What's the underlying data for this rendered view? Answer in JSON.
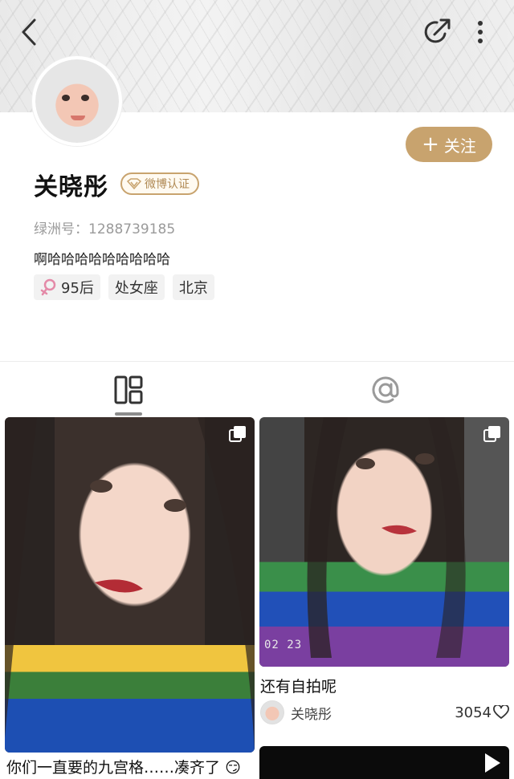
{
  "header": {
    "back_icon": "chevron-left-icon",
    "share_icon": "share-arrow-icon",
    "more_icon": "more-vertical-icon"
  },
  "profile": {
    "name": "关晓彤",
    "verify_badge": "微博认证",
    "lz_label": "绿洲号：",
    "lz_id": "1288739185",
    "bio": "啊哈哈哈哈哈哈哈哈哈",
    "follow_label": "关注",
    "tags": [
      "95后",
      "处女座",
      "北京"
    ]
  },
  "tabs": {
    "grid_icon": "grid-layout-icon",
    "mention_icon": "at-sign-icon"
  },
  "posts": [
    {
      "caption": "你们一直要的九宫格……凑齐了",
      "emoji": "😏"
    },
    {
      "date_stamp": "02 23",
      "caption": "还有自拍呢",
      "author": "关晓彤",
      "likes": "3054"
    }
  ],
  "colors": {
    "accent": "#c8a36e",
    "text": "#222222",
    "muted": "#9a9a9a"
  }
}
